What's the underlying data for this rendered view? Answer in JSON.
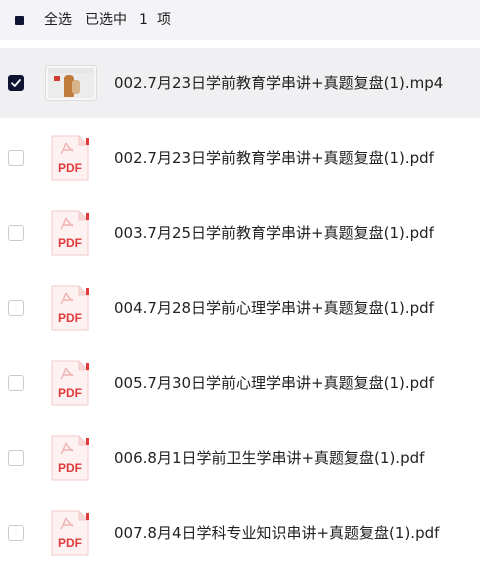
{
  "toolbar": {
    "select_all_label": "全选",
    "selected_prefix": "已选中",
    "selected_count": "1",
    "selected_suffix": "项"
  },
  "file_type_label": "PDF",
  "files": [
    {
      "name": "002.7月23日学前教育学串讲+真题复盘(1).mp4",
      "type": "video",
      "checked": true
    },
    {
      "name": "002.7月23日学前教育学串讲+真题复盘(1).pdf",
      "type": "pdf",
      "checked": false
    },
    {
      "name": "003.7月25日学前教育学串讲+真题复盘(1).pdf",
      "type": "pdf",
      "checked": false
    },
    {
      "name": "004.7月28日学前心理学串讲+真题复盘(1).pdf",
      "type": "pdf",
      "checked": false
    },
    {
      "name": "005.7月30日学前心理学串讲+真题复盘(1).pdf",
      "type": "pdf",
      "checked": false
    },
    {
      "name": "006.8月1日学前卫生学串讲+真题复盘(1).pdf",
      "type": "pdf",
      "checked": false
    },
    {
      "name": "007.8月4日学科专业知识串讲+真题复盘(1).pdf",
      "type": "pdf",
      "checked": false
    }
  ],
  "colors": {
    "accent_dark": "#0f1433",
    "pdf_red": "#e03a3a",
    "selected_row_bg": "#f0f0f2",
    "toolbar_bg": "#f4f4f6"
  }
}
